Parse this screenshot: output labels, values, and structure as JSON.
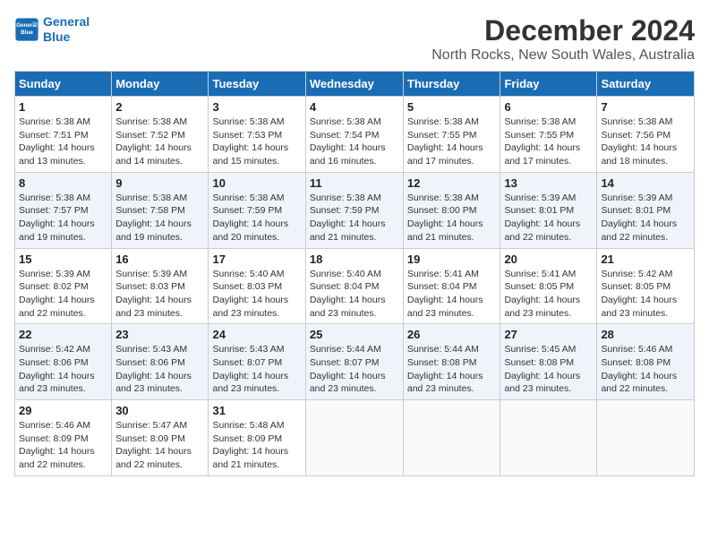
{
  "logo": {
    "line1": "General",
    "line2": "Blue"
  },
  "title": "December 2024",
  "location": "North Rocks, New South Wales, Australia",
  "days_of_week": [
    "Sunday",
    "Monday",
    "Tuesday",
    "Wednesday",
    "Thursday",
    "Friday",
    "Saturday"
  ],
  "weeks": [
    [
      {
        "day": "1",
        "info": "Sunrise: 5:38 AM\nSunset: 7:51 PM\nDaylight: 14 hours\nand 13 minutes."
      },
      {
        "day": "2",
        "info": "Sunrise: 5:38 AM\nSunset: 7:52 PM\nDaylight: 14 hours\nand 14 minutes."
      },
      {
        "day": "3",
        "info": "Sunrise: 5:38 AM\nSunset: 7:53 PM\nDaylight: 14 hours\nand 15 minutes."
      },
      {
        "day": "4",
        "info": "Sunrise: 5:38 AM\nSunset: 7:54 PM\nDaylight: 14 hours\nand 16 minutes."
      },
      {
        "day": "5",
        "info": "Sunrise: 5:38 AM\nSunset: 7:55 PM\nDaylight: 14 hours\nand 17 minutes."
      },
      {
        "day": "6",
        "info": "Sunrise: 5:38 AM\nSunset: 7:55 PM\nDaylight: 14 hours\nand 17 minutes."
      },
      {
        "day": "7",
        "info": "Sunrise: 5:38 AM\nSunset: 7:56 PM\nDaylight: 14 hours\nand 18 minutes."
      }
    ],
    [
      {
        "day": "8",
        "info": "Sunrise: 5:38 AM\nSunset: 7:57 PM\nDaylight: 14 hours\nand 19 minutes."
      },
      {
        "day": "9",
        "info": "Sunrise: 5:38 AM\nSunset: 7:58 PM\nDaylight: 14 hours\nand 19 minutes."
      },
      {
        "day": "10",
        "info": "Sunrise: 5:38 AM\nSunset: 7:59 PM\nDaylight: 14 hours\nand 20 minutes."
      },
      {
        "day": "11",
        "info": "Sunrise: 5:38 AM\nSunset: 7:59 PM\nDaylight: 14 hours\nand 21 minutes."
      },
      {
        "day": "12",
        "info": "Sunrise: 5:38 AM\nSunset: 8:00 PM\nDaylight: 14 hours\nand 21 minutes."
      },
      {
        "day": "13",
        "info": "Sunrise: 5:39 AM\nSunset: 8:01 PM\nDaylight: 14 hours\nand 22 minutes."
      },
      {
        "day": "14",
        "info": "Sunrise: 5:39 AM\nSunset: 8:01 PM\nDaylight: 14 hours\nand 22 minutes."
      }
    ],
    [
      {
        "day": "15",
        "info": "Sunrise: 5:39 AM\nSunset: 8:02 PM\nDaylight: 14 hours\nand 22 minutes."
      },
      {
        "day": "16",
        "info": "Sunrise: 5:39 AM\nSunset: 8:03 PM\nDaylight: 14 hours\nand 23 minutes."
      },
      {
        "day": "17",
        "info": "Sunrise: 5:40 AM\nSunset: 8:03 PM\nDaylight: 14 hours\nand 23 minutes."
      },
      {
        "day": "18",
        "info": "Sunrise: 5:40 AM\nSunset: 8:04 PM\nDaylight: 14 hours\nand 23 minutes."
      },
      {
        "day": "19",
        "info": "Sunrise: 5:41 AM\nSunset: 8:04 PM\nDaylight: 14 hours\nand 23 minutes."
      },
      {
        "day": "20",
        "info": "Sunrise: 5:41 AM\nSunset: 8:05 PM\nDaylight: 14 hours\nand 23 minutes."
      },
      {
        "day": "21",
        "info": "Sunrise: 5:42 AM\nSunset: 8:05 PM\nDaylight: 14 hours\nand 23 minutes."
      }
    ],
    [
      {
        "day": "22",
        "info": "Sunrise: 5:42 AM\nSunset: 8:06 PM\nDaylight: 14 hours\nand 23 minutes."
      },
      {
        "day": "23",
        "info": "Sunrise: 5:43 AM\nSunset: 8:06 PM\nDaylight: 14 hours\nand 23 minutes."
      },
      {
        "day": "24",
        "info": "Sunrise: 5:43 AM\nSunset: 8:07 PM\nDaylight: 14 hours\nand 23 minutes."
      },
      {
        "day": "25",
        "info": "Sunrise: 5:44 AM\nSunset: 8:07 PM\nDaylight: 14 hours\nand 23 minutes."
      },
      {
        "day": "26",
        "info": "Sunrise: 5:44 AM\nSunset: 8:08 PM\nDaylight: 14 hours\nand 23 minutes."
      },
      {
        "day": "27",
        "info": "Sunrise: 5:45 AM\nSunset: 8:08 PM\nDaylight: 14 hours\nand 23 minutes."
      },
      {
        "day": "28",
        "info": "Sunrise: 5:46 AM\nSunset: 8:08 PM\nDaylight: 14 hours\nand 22 minutes."
      }
    ],
    [
      {
        "day": "29",
        "info": "Sunrise: 5:46 AM\nSunset: 8:09 PM\nDaylight: 14 hours\nand 22 minutes."
      },
      {
        "day": "30",
        "info": "Sunrise: 5:47 AM\nSunset: 8:09 PM\nDaylight: 14 hours\nand 22 minutes."
      },
      {
        "day": "31",
        "info": "Sunrise: 5:48 AM\nSunset: 8:09 PM\nDaylight: 14 hours\nand 21 minutes."
      },
      {
        "day": "",
        "info": ""
      },
      {
        "day": "",
        "info": ""
      },
      {
        "day": "",
        "info": ""
      },
      {
        "day": "",
        "info": ""
      }
    ]
  ]
}
